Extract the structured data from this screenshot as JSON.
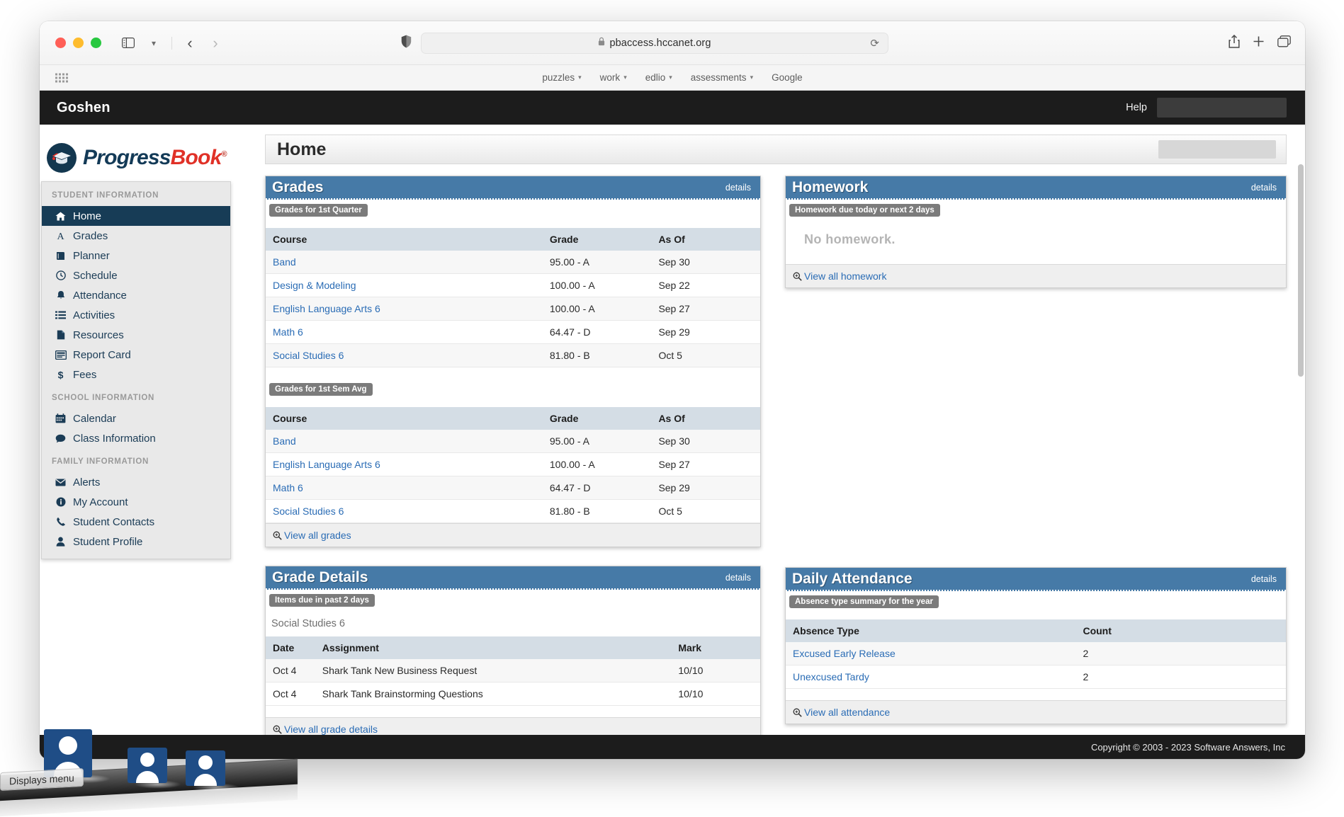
{
  "browser": {
    "url": "pbaccess.hccanet.org",
    "lock_icon": "lock-icon",
    "reload_icon": "reload-icon",
    "shield_icon": "privacy-shield-icon",
    "sidebar_icon": "sidebar-toggle-icon",
    "back_icon": "back-arrow-icon",
    "forward_icon": "forward-arrow-icon",
    "share_icon": "share-icon",
    "new_tab_icon": "new-tab-icon",
    "tab_overview_icon": "tab-overview-icon",
    "bookmarks": [
      {
        "label": "puzzles",
        "has_caret": true
      },
      {
        "label": "work",
        "has_caret": true
      },
      {
        "label": "edlio",
        "has_caret": true
      },
      {
        "label": "assessments",
        "has_caret": true
      },
      {
        "label": "Google",
        "has_caret": false
      }
    ]
  },
  "site": {
    "district": "Goshen",
    "help_label": "Help",
    "page_title": "Home",
    "copyright": "Copyright © 2003 - 2023 Software Answers, Inc",
    "logo": {
      "part1": "Progress",
      "part2": "Book",
      "registered": "®",
      "color_navy": "#133a57",
      "color_red": "#e03127"
    }
  },
  "sidebar": {
    "sections": [
      {
        "title": "STUDENT INFORMATION",
        "items": [
          {
            "label": "Home",
            "icon": "home-icon",
            "active": true
          },
          {
            "label": "Grades",
            "icon": "letter-a-icon",
            "active": false
          },
          {
            "label": "Planner",
            "icon": "book-icon",
            "active": false
          },
          {
            "label": "Schedule",
            "icon": "clock-icon",
            "active": false
          },
          {
            "label": "Attendance",
            "icon": "bell-icon",
            "active": false
          },
          {
            "label": "Activities",
            "icon": "list-icon",
            "active": false
          },
          {
            "label": "Resources",
            "icon": "file-icon",
            "active": false
          },
          {
            "label": "Report Card",
            "icon": "report-card-icon",
            "active": false
          },
          {
            "label": "Fees",
            "icon": "dollar-icon",
            "active": false
          }
        ]
      },
      {
        "title": "SCHOOL INFORMATION",
        "items": [
          {
            "label": "Calendar",
            "icon": "calendar-icon",
            "active": false
          },
          {
            "label": "Class Information",
            "icon": "comment-icon",
            "active": false
          }
        ]
      },
      {
        "title": "FAMILY INFORMATION",
        "items": [
          {
            "label": "Alerts",
            "icon": "envelope-icon",
            "active": false
          },
          {
            "label": "My Account",
            "icon": "info-icon",
            "active": false
          },
          {
            "label": "Student Contacts",
            "icon": "phone-icon",
            "active": false
          },
          {
            "label": "Student Profile",
            "icon": "person-icon",
            "active": false
          }
        ]
      }
    ]
  },
  "panels": {
    "grades": {
      "title": "Grades",
      "details_label": "details",
      "sections": [
        {
          "chip": "Grades for 1st Quarter",
          "columns": [
            "Course",
            "Grade",
            "As Of"
          ],
          "rows": [
            [
              "Band",
              "95.00 - A",
              "Sep 30"
            ],
            [
              "Design & Modeling",
              "100.00 - A",
              "Sep 22"
            ],
            [
              "English Language Arts 6",
              "100.00 - A",
              "Sep 27"
            ],
            [
              "Math 6",
              "64.47 - D",
              "Sep 29"
            ],
            [
              "Social Studies 6",
              "81.80 - B",
              "Oct 5"
            ]
          ]
        },
        {
          "chip": "Grades for 1st Sem Avg",
          "columns": [
            "Course",
            "Grade",
            "As Of"
          ],
          "rows": [
            [
              "Band",
              "95.00 - A",
              "Sep 30"
            ],
            [
              "English Language Arts 6",
              "100.00 - A",
              "Sep 27"
            ],
            [
              "Math 6",
              "64.47 - D",
              "Sep 29"
            ],
            [
              "Social Studies 6",
              "81.80 - B",
              "Oct 5"
            ]
          ]
        }
      ],
      "footer_link": "View all grades",
      "footer_icon": "magnifier-icon"
    },
    "homework": {
      "title": "Homework",
      "details_label": "details",
      "chip": "Homework due today or next 2 days",
      "empty_message": "No homework.",
      "footer_link": "View all homework",
      "footer_icon": "magnifier-icon"
    },
    "grade_details": {
      "title": "Grade Details",
      "details_label": "details",
      "chip": "Items due in past 2 days",
      "course": "Social Studies 6",
      "columns": [
        "Date",
        "Assignment",
        "Mark"
      ],
      "rows": [
        [
          "Oct 4",
          "Shark Tank New Business Request",
          "10/10"
        ],
        [
          "Oct 4",
          "Shark Tank Brainstorming Questions",
          "10/10"
        ]
      ],
      "footer_link": "View all grade details",
      "footer_icon": "magnifier-icon"
    },
    "daily_attendance": {
      "title": "Daily Attendance",
      "details_label": "details",
      "chip": "Absence type summary for the year",
      "columns": [
        "Absence Type",
        "Count"
      ],
      "rows": [
        [
          "Excused Early Release",
          "2"
        ],
        [
          "Unexcused Tardy",
          "2"
        ]
      ],
      "footer_link": "View all attendance",
      "footer_icon": "magnifier-icon"
    }
  },
  "dock": {
    "tooltip": "Displays menu",
    "apps": [
      {
        "icon": "person-app-icon"
      },
      {
        "icon": "person-app-icon"
      },
      {
        "icon": "person-app-icon"
      }
    ]
  },
  "colors": {
    "panel_header": "#467aa7",
    "sidebar_active": "#173c56",
    "link": "#2a6cb5",
    "chip": "#7b7b7b",
    "table_header": "#d4dde5"
  }
}
